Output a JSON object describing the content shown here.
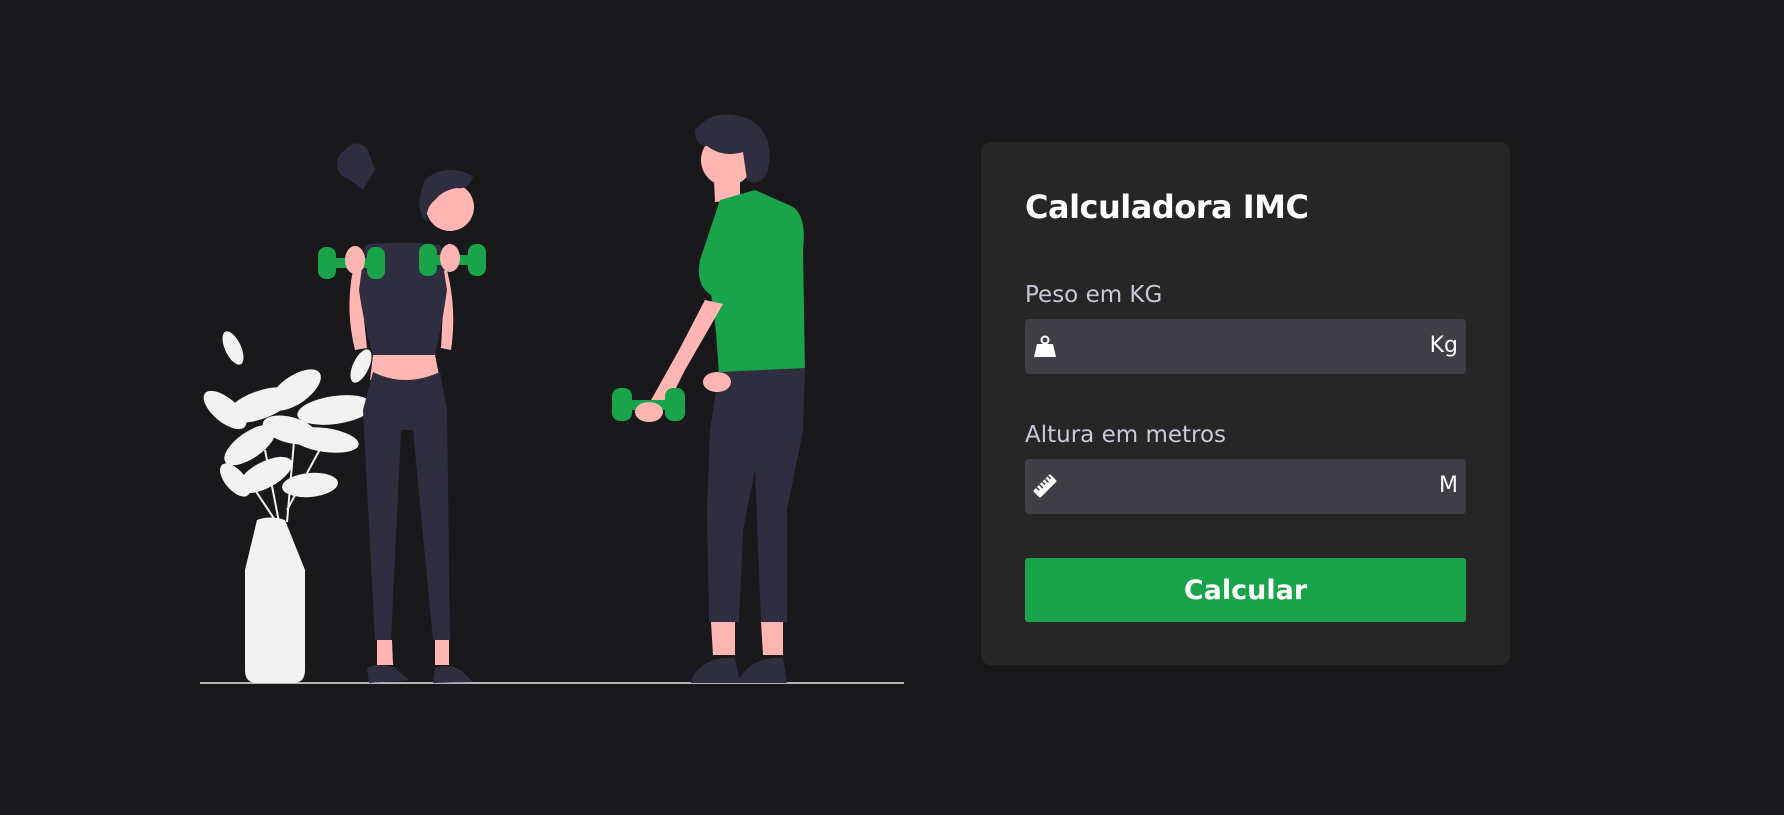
{
  "app": {
    "title": "Calculadora IMC"
  },
  "form": {
    "weight": {
      "label": "Peso em KG",
      "value": "",
      "unit": "Kg",
      "icon": "weight-icon"
    },
    "height": {
      "label": "Altura em metros",
      "value": "",
      "unit": "M",
      "icon": "ruler-icon"
    },
    "submit_label": "Calcular"
  },
  "colors": {
    "background": "#19191b",
    "card": "#262626",
    "input": "#3e3e44",
    "accent": "#19a34a",
    "label": "#c8c9d6",
    "skin": "#ffb6b3",
    "figure_dark": "#2f2e41",
    "plant": "#f2f2f2"
  }
}
